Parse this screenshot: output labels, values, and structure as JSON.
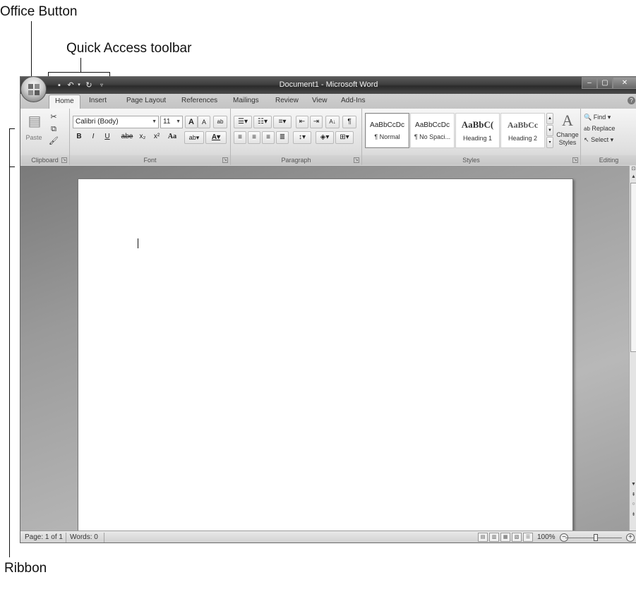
{
  "callouts": {
    "office_button": "Office Button",
    "quick_access": "Quick Access toolbar",
    "ribbon": "Ribbon"
  },
  "window": {
    "title": "Document1 - Microsoft Word",
    "controls": [
      "–",
      "▢",
      "✕"
    ]
  },
  "tabs": [
    "Home",
    "Insert",
    "Page Layout",
    "References",
    "Mailings",
    "Review",
    "View",
    "Add-Ins"
  ],
  "active_tab": "Home",
  "ribbon": {
    "clipboard": {
      "label": "Clipboard",
      "paste": "Paste"
    },
    "font": {
      "label": "Font",
      "name": "Calibri (Body)",
      "size": "11",
      "bold": "B",
      "italic": "I",
      "underline": "U",
      "strike": "abe",
      "subscript": "x₂",
      "superscript": "x²",
      "change_case": "Aa",
      "grow": "A",
      "shrink": "A"
    },
    "paragraph": {
      "label": "Paragraph"
    },
    "styles": {
      "label": "Styles",
      "items": [
        {
          "sample": "AaBbCcDc",
          "name": "¶ Normal"
        },
        {
          "sample": "AaBbCcDc",
          "name": "¶ No Spaci..."
        },
        {
          "sample": "AaBbC(",
          "name": "Heading 1"
        },
        {
          "sample": "AaBbCc",
          "name": "Heading 2"
        }
      ],
      "change_styles_1": "Change",
      "change_styles_2": "Styles"
    },
    "editing": {
      "label": "Editing",
      "find": "Find",
      "replace": "Replace",
      "select": "Select"
    }
  },
  "status": {
    "page": "Page: 1 of 1",
    "words": "Words: 0",
    "zoom": "100%"
  }
}
